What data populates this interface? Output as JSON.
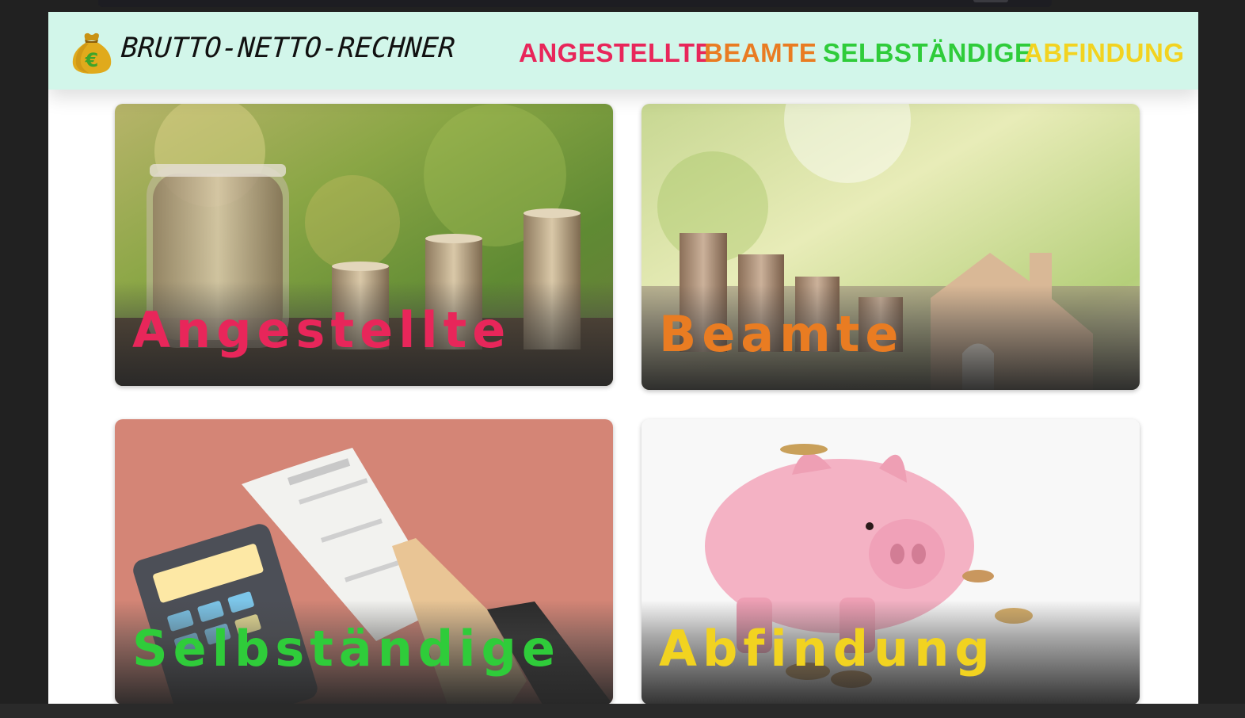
{
  "brand": {
    "title": "BRUTTO-NETTO-RECHNER",
    "logo_icon": "money-bag-icon",
    "logo_symbol": "€"
  },
  "nav": [
    {
      "label": "ANGESTELLTE",
      "color": "#e8265a"
    },
    {
      "label": "BEAMTE",
      "color": "#e97c22"
    },
    {
      "label": "SELBSTÄNDIGE",
      "color": "#2fcc3a"
    },
    {
      "label": "ABFINDUNG",
      "color": "#f2d320"
    }
  ],
  "cards": [
    {
      "title": "Angestellte",
      "color": "#e8265a",
      "image": "coin-jar-and-stacks"
    },
    {
      "title": "Beamte",
      "color": "#e97c22",
      "image": "coin-stacks-and-wooden-house"
    },
    {
      "title": "Selbständige",
      "color": "#2fcc3a",
      "image": "calculator-and-invoice"
    },
    {
      "title": "Abfindung",
      "color": "#f2d320",
      "image": "piggy-bank-and-coins"
    }
  ],
  "colors": {
    "header_bg": "#d2f6ea",
    "page_bg": "#ffffff",
    "frame_bg": "#212121"
  }
}
